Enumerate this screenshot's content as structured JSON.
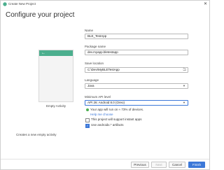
{
  "window": {
    "title": "Create New Project",
    "close_icon": "close-icon"
  },
  "page_title": "Configure your project",
  "template": {
    "name": "Empty Activity",
    "description": "Creates a new empty activity"
  },
  "fields": {
    "name": {
      "label": "Name",
      "value": "BLE_TestApp"
    },
    "package": {
      "label": "Package name",
      "value": "dev.myapp.bletestapp"
    },
    "save_location": {
      "label": "Save location",
      "value": "C:\\Dev\\MyBLETestApp"
    },
    "language": {
      "label": "Language",
      "value": "Java"
    },
    "min_api": {
      "label": "Minimum API level",
      "value": "API 26: Android 8.0 (Oreo)"
    }
  },
  "api_info": {
    "text": "Your app will run on ≈ 73% of devices.",
    "link": "Help me choose"
  },
  "checkboxes": [
    {
      "label": "This project will support instant apps",
      "checked": false
    },
    {
      "label": "Use androidx.* artifacts",
      "checked": true
    }
  ],
  "buttons": {
    "previous": "Previous",
    "next": "Next",
    "cancel": "Cancel",
    "finish": "Finish"
  },
  "colors": {
    "accent": "#3c78d8",
    "template_bar": "#4caf8e",
    "success": "#4caf50"
  }
}
